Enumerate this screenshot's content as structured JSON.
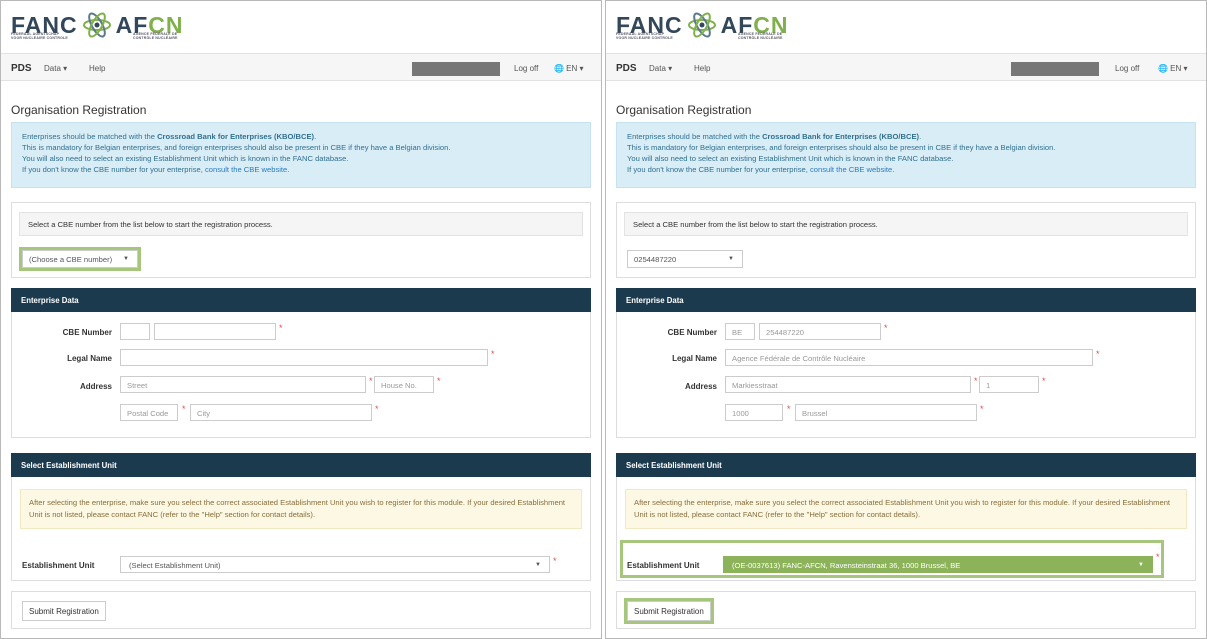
{
  "logo": {
    "left": "FANC",
    "right_a": "AF",
    "right_b": "CN",
    "sub_left": "FEDERAAL AGENTSCHAP VOOR NUCLEAIRE CONTROLE",
    "sub_right": "AGENCE FÉDÉRALE DE CONTRÔLE NUCLÉAIRE"
  },
  "navbar": {
    "brand": "PDS",
    "data_menu": "Data ▾",
    "help": "Help",
    "logoff": "Log off",
    "lang": "🌐 EN ▾"
  },
  "page_title": "Organisation Registration",
  "info": {
    "line1_pre": "Enterprises should be matched with the ",
    "line1_strong": "Crossroad Bank for Enterprises (KBO/BCE)",
    "line1_post": ".",
    "line2": "This is mandatory for Belgian enterprises, and foreign enterprises should also be present in CBE if they have a Belgian division.",
    "line3": "You will also need to select an existing Establishment Unit which is known in the FANC database.",
    "line4_pre": "If you don't know the CBE number for your enterprise, ",
    "line4_link": "consult the CBE website",
    "line4_post": "."
  },
  "cbe_prompt": "Select a CBE number from the list below to start the registration process.",
  "enterprise": {
    "header": "Enterprise Data",
    "cbe_label": "CBE Number",
    "legal_label": "Legal Name",
    "address_label": "Address"
  },
  "establishment": {
    "header": "Select Establishment Unit",
    "warning": "After selecting the enterprise, make sure you select the correct associated Establishment Unit you wish to register for this module. If your desired Establishment Unit is not listed, please contact FANC (refer to the \"Help\" section for contact details).",
    "label": "Establishment Unit"
  },
  "submit_label": "Submit Registration",
  "left": {
    "cbe_select": "(Choose a CBE number)",
    "cbe_prefix": "",
    "cbe_number": "",
    "legal_name": "",
    "street": "Street",
    "house_no": "House No.",
    "postal_code": "Postal Code",
    "city": "City",
    "est_unit": "(Select Establishment Unit)"
  },
  "right": {
    "cbe_select": "0254487220",
    "cbe_prefix": "BE",
    "cbe_number": "254487220",
    "legal_name": "Agence Fédérale de Contrôle Nucléaire",
    "street": "Markiesstraat",
    "house_no": "1",
    "postal_code": "1000",
    "city": "Brussel",
    "est_unit": "(OE-0037613) FANC-AFCN, Ravensteinstraat 36, 1000 Brussel, BE"
  },
  "colors": {
    "navy": "#1c3a4e",
    "highlight": "#a7c67d",
    "info_bg": "#d9edf7",
    "warn_bg": "#fcf8e3"
  }
}
